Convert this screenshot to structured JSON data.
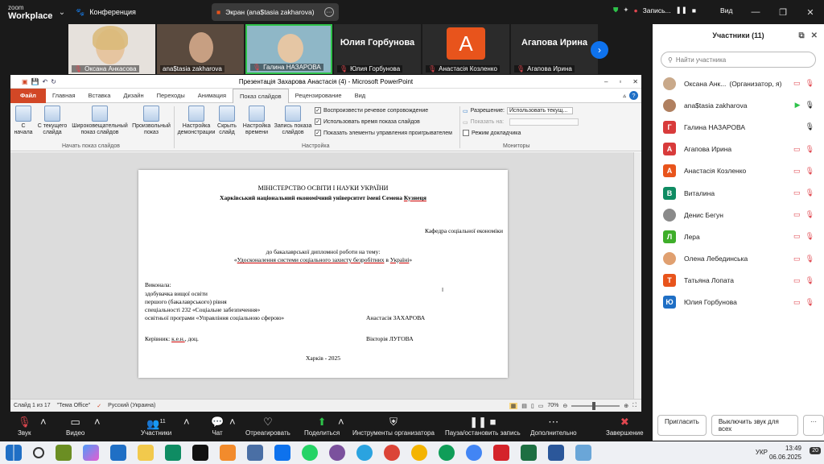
{
  "zoom": {
    "logo_line1": "zoom",
    "logo_line2": "Workplace",
    "conference": "Конференция",
    "screen_share": "Экран (ana$tasia zakharova)",
    "recording": "Запись...",
    "view": "Вид"
  },
  "videos": [
    {
      "name": "Оксана Анкасова"
    },
    {
      "name": "ana$tasia zakharova"
    },
    {
      "name": "Галина НАЗАРОВА"
    },
    {
      "name": "Юлия Горбунова",
      "big": "Юлия Горбунова"
    },
    {
      "name": "Анастасія Козленко",
      "initial": "А"
    },
    {
      "name": "Агапова Ирина",
      "big": "Агапова Ирина"
    }
  ],
  "ppt": {
    "title": "Презентація Захарова Анастасія (4)  -  Microsoft PowerPoint",
    "tabs": [
      "Файл",
      "Главная",
      "Вставка",
      "Дизайн",
      "Переходы",
      "Анимация",
      "Показ слайдов",
      "Рецензирование",
      "Вид"
    ],
    "ribbon": {
      "from_start": "С начала",
      "from_current": "С текущего слайда",
      "broadcast": "Широковещательный показ слайдов",
      "custom": "Произвольный показ",
      "group1": "Начать показ слайдов",
      "setup": "Настройка демонстрации",
      "hide": "Скрыть слайд",
      "rehearse": "Настройка времени",
      "record": "Запись показа слайдов",
      "chk1": "Воспроизвести речевое сопровождение",
      "chk2": "Использовать время показа слайдов",
      "chk3": "Показать элементы управления проигрывателем",
      "group2": "Настройка",
      "resolution_label": "Разрешение:",
      "resolution_value": "Использовать текущ...",
      "show_on": "Показать на:",
      "presenter": "Режим докладчика",
      "group3": "Мониторы"
    },
    "slide": {
      "ministry": "МІНІСТЕРСТВО  ОСВІТИ І НАУКИ УКРАЇНИ",
      "univ_a": "Харківський  національний економічний університет  імені Семена ",
      "univ_b": "Кузнеця",
      "dept": "Кафедра соціальної економіки",
      "to": "до бакалаврської дипломної роботи на тему:",
      "topic_q1": "«",
      "topic_a": "Удосконалення системи соціального захисту безробітних",
      "topic_b": " в ",
      "topic_c": "Україні",
      "topic_q2": "»",
      "done": "Виконала:",
      "l1": "здобувачка вищої освіти",
      "l2": "першого (бакалаврського) рівня",
      "l3": "спеціальності 232 «Соціальне забезпечення»",
      "l4": "освітньої програми «Управління соціальною сферою»",
      "student": "Анастасія  ЗАХАРОВА",
      "supervisor_label": "Керівник: ",
      "supervisor_deg": "к.е.н.",
      "supervisor_rest": ", доц.",
      "supervisor": "Вікторія ЛУГОВА",
      "city": "Харків - 2025"
    },
    "status": {
      "slide": "Слайд 1 из 17",
      "theme": "\"Тема Office\"",
      "lang": "Русский (Украина)",
      "zoom": "70%"
    }
  },
  "panel": {
    "title": "Участники (11)",
    "search_placeholder": "Найти участника",
    "participants": [
      {
        "name": "Оксана Анк...",
        "role": "(Организатор, я)",
        "av": "",
        "color": "#c9a98a"
      },
      {
        "name": "ana$tasia zakharova",
        "av": "",
        "color": "#b08060"
      },
      {
        "name": "Галина НАЗАРОВА",
        "av": "Г",
        "color": "#d83b3b"
      },
      {
        "name": "Агапова Ирина",
        "av": "А",
        "color": "#d83b3b"
      },
      {
        "name": "Анастасія Козленко",
        "av": "А",
        "color": "#e8541c"
      },
      {
        "name": "Виталина",
        "av": "В",
        "color": "#0f8c63"
      },
      {
        "name": "Денис Бегун",
        "av": "",
        "color": "#8a8a8a"
      },
      {
        "name": "Лера",
        "av": "Л",
        "color": "#3fae2a"
      },
      {
        "name": "Олена Лебединська",
        "av": "",
        "color": "#e0a070"
      },
      {
        "name": "Татьяна Лопата",
        "av": "Т",
        "color": "#e8541c"
      },
      {
        "name": "Юлия Горбунова",
        "av": "Ю",
        "color": "#1f6fc5"
      }
    ],
    "invite": "Пригласить",
    "unmute_all": "Выключить звук для всех"
  },
  "toolbar": {
    "audio": "Звук",
    "video": "Видео",
    "participants": "Участники",
    "participants_count": "11",
    "chat": "Чат",
    "react": "Отреагировать",
    "share": "Поделиться",
    "host_tools": "Инструменты организатора",
    "pause": "Пауза/остановить запись",
    "more": "Дополнительно",
    "end": "Завершение"
  },
  "taskbar": {
    "lang": "УКР",
    "time": "13:49",
    "date": "06.06.2025",
    "notif": "20"
  }
}
